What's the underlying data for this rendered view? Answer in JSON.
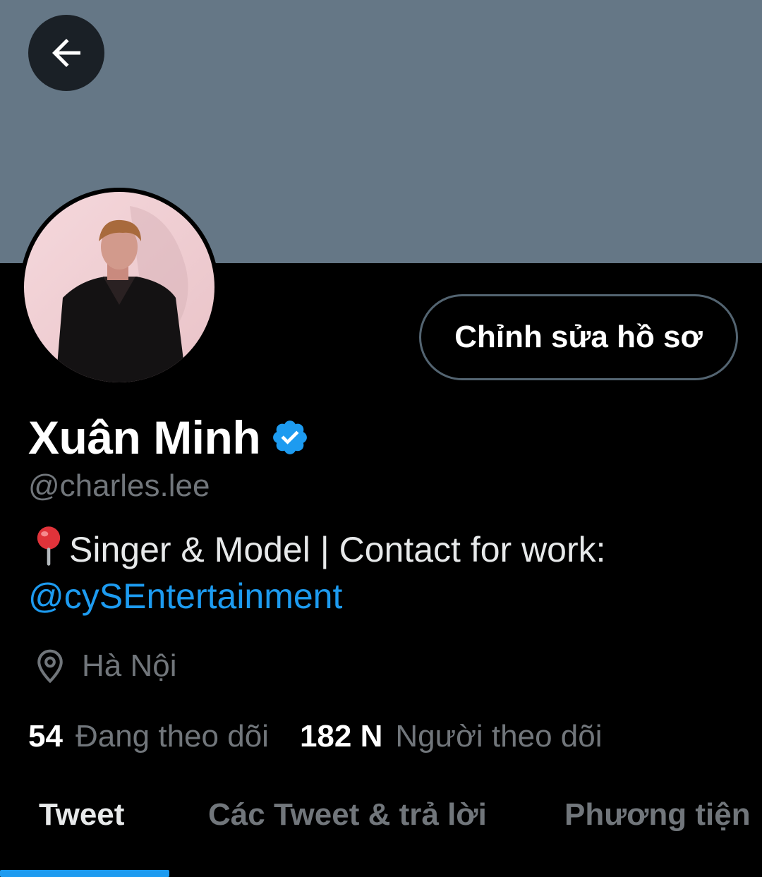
{
  "colors": {
    "banner": "#657786",
    "accent": "#1d9bf0",
    "secondary_text": "#71767b",
    "background": "#000000"
  },
  "header": {
    "back_icon": "arrow-left-icon"
  },
  "profile": {
    "avatar_icon": "avatar-photo",
    "edit_button_label": "Chỉnh sửa hồ sơ",
    "display_name": "Xuân Minh",
    "verified_icon": "verified-badge-icon",
    "handle": "@charles.lee",
    "bio_pin_icon": "pushpin-icon",
    "bio_text": "Singer & Model | Contact for work:",
    "bio_link": "@cySEntertainment",
    "location_icon": "location-pin-icon",
    "location": "Hà Nội",
    "following_count": "54",
    "following_label": "Đang theo dõi",
    "followers_count": "182 N",
    "followers_label": "Người theo dõi"
  },
  "tabs": [
    {
      "label": "Tweet",
      "active": true
    },
    {
      "label": "Các Tweet & trả lời",
      "active": false
    },
    {
      "label": "Phương tiện",
      "active": false
    }
  ]
}
